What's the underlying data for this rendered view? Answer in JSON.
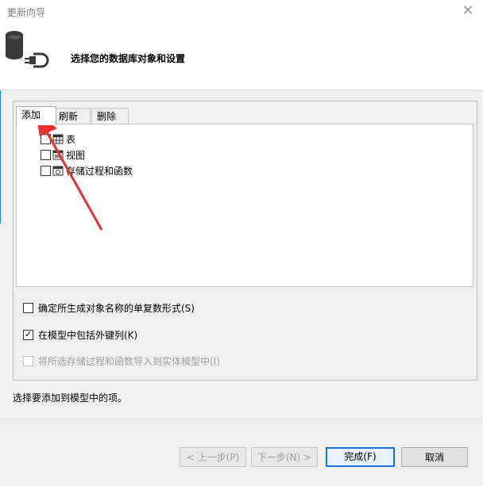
{
  "window": {
    "title": "更新向导",
    "close_glyph": "✕"
  },
  "header": {
    "title": "选择您的数据库对象和设置",
    "icon": "database-plug-icon"
  },
  "tabs": [
    {
      "label": "添加",
      "active": true
    },
    {
      "label": "刷新",
      "active": false
    },
    {
      "label": "删除",
      "active": false
    }
  ],
  "tree": {
    "items": [
      {
        "label": "表",
        "checked": false,
        "icon": "table-icon"
      },
      {
        "label": "视图",
        "checked": false,
        "icon": "view-icon"
      },
      {
        "label": "存储过程和函数",
        "checked": false,
        "icon": "stored-procedure-icon"
      }
    ]
  },
  "options": [
    {
      "label": "确定所生成对象名称的单复数形式(S)",
      "checked": false,
      "enabled": true
    },
    {
      "label": "在模型中包括外键列(K)",
      "checked": true,
      "enabled": true
    },
    {
      "label": "将所选存储过程和函数导入到实体模型中(I)",
      "checked": false,
      "enabled": false
    }
  ],
  "status": {
    "text": "选择要添加到模型中的项。"
  },
  "buttons": {
    "prev": "< 上一步(P)",
    "next": "下一步(N) >",
    "finish": "完成(F)",
    "cancel": "取消"
  },
  "colors": {
    "accent": "#1a72d6",
    "annotation_arrow": "#e8322d"
  }
}
